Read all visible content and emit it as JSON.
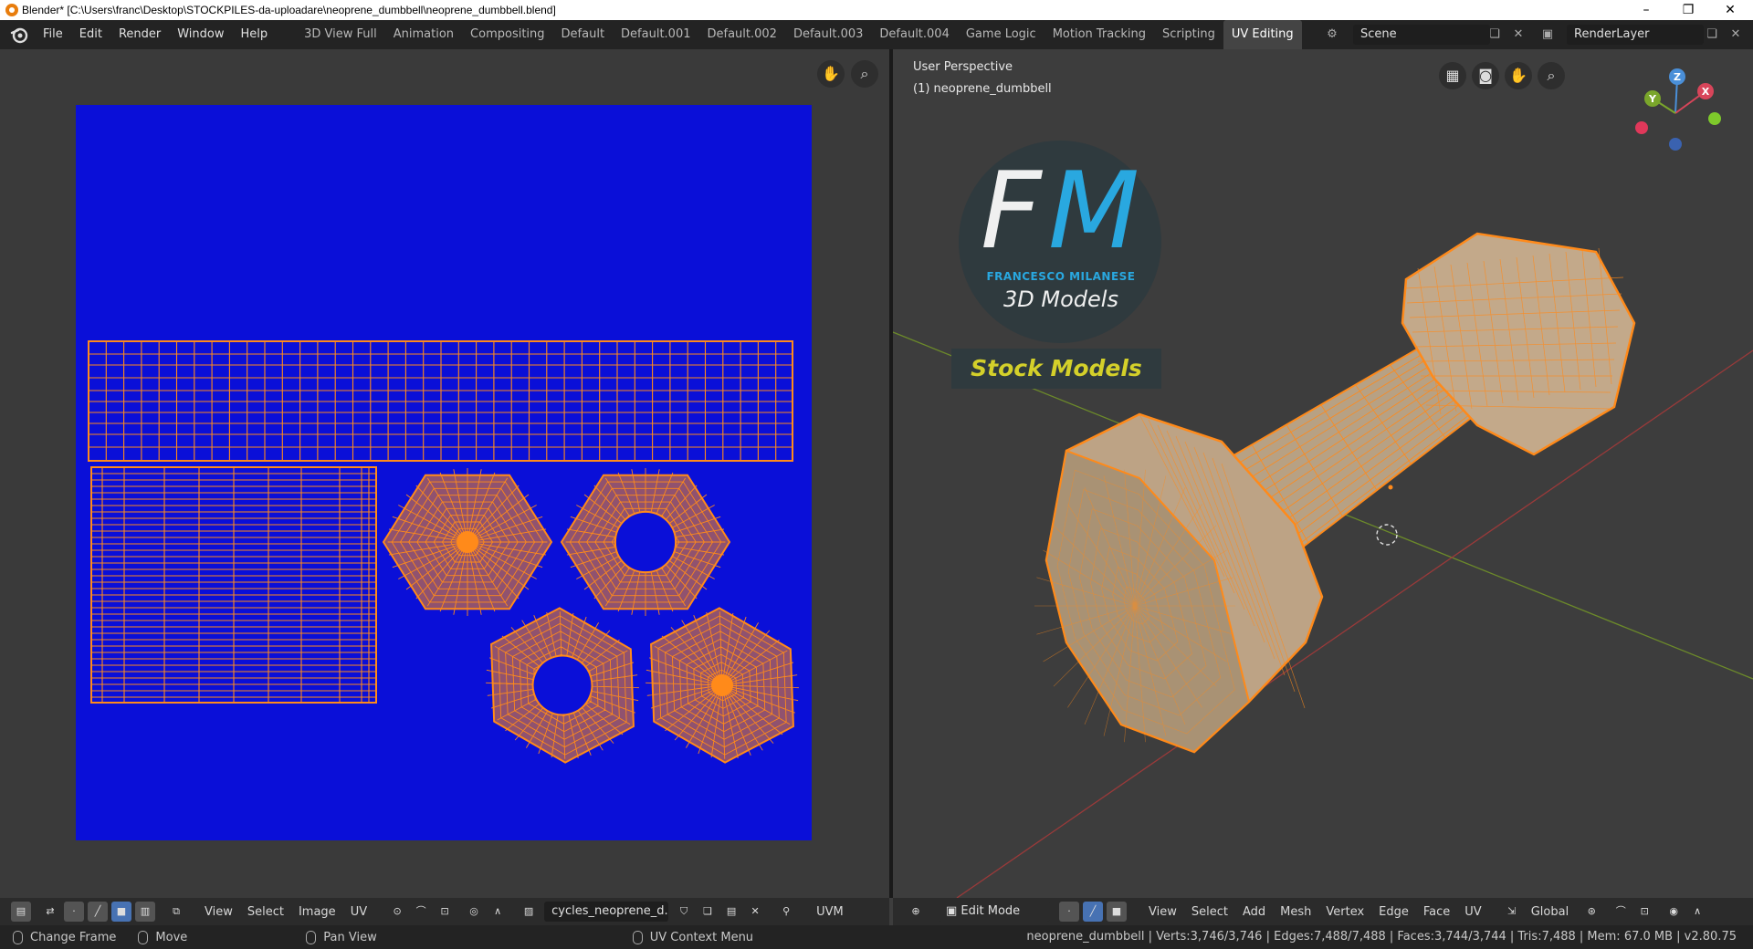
{
  "window": {
    "title": "Blender* [C:\\Users\\franc\\Desktop\\STOCKPILES-da-uploadare\\neoprene_dumbbell\\neoprene_dumbbell.blend]",
    "minimize": "–",
    "restore": "❐",
    "close": "✕"
  },
  "menu": [
    "File",
    "Edit",
    "Render",
    "Window",
    "Help"
  ],
  "workspaces": [
    "3D View Full",
    "Animation",
    "Compositing",
    "Default",
    "Default.001",
    "Default.002",
    "Default.003",
    "Default.004",
    "Game Logic",
    "Motion Tracking",
    "Scripting",
    "UV Editing"
  ],
  "active_workspace": "UV Editing",
  "scene": {
    "name": "Scene",
    "render_layer": "RenderLayer"
  },
  "uv_editor": {
    "header_menus": [
      "View",
      "Select",
      "Image",
      "UV"
    ],
    "image_name": "cycles_neoprene_d..",
    "uvmap_label": "UVM",
    "colors": {
      "background": "#0a0fd8",
      "wire": "#ff8a1a"
    }
  },
  "viewport": {
    "perspective": "User Perspective",
    "object_label": "(1) neoprene_dumbbell",
    "mode": "Edit Mode",
    "header_menus": [
      "View",
      "Select",
      "Add",
      "Mesh",
      "Vertex",
      "Edge",
      "Face",
      "UV"
    ],
    "orientation": "Global",
    "gizmo": {
      "x": "X",
      "y": "Y",
      "z": "Z"
    }
  },
  "logo": {
    "f": "F",
    "m": "M",
    "subtitle": "FRANCESCO MILANESE",
    "models": "3D Models",
    "stock": "Stock Models"
  },
  "status": {
    "hints": [
      "Change Frame",
      "Move",
      "Pan View",
      "UV Context Menu"
    ],
    "stats": "neoprene_dumbbell | Verts:3,746/3,746 | Edges:7,488/7,488 | Faces:3,744/3,744 | Tris:7,488 | Mem: 67.0 MB | v2.80.75"
  }
}
